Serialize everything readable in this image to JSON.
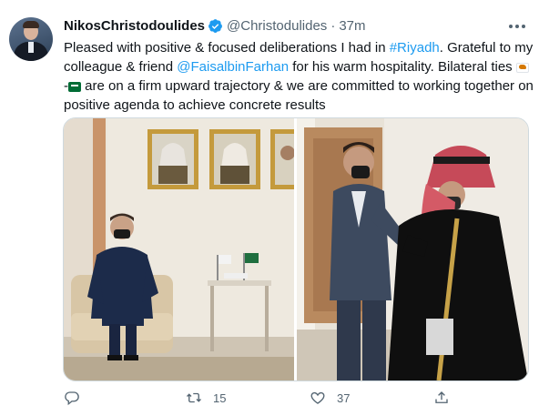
{
  "tweet": {
    "author_name": "NikosChristodoulides",
    "author_handle": "@Christodulides",
    "separator": "·",
    "timestamp": "37m",
    "text": {
      "p1": "Pleased with positive & focused deliberations I had in ",
      "hashtag": "#Riyadh",
      "p2": ". Grateful to my colleague & friend ",
      "mention": "@FaisalbinFarhan",
      "p3": " for his warm hospitality. Bilateral ties ",
      "flag_sep": "-",
      "p4": " are on a firm upward trajectory & we are committed to working together on positive agenda to achieve concrete results"
    },
    "flags": [
      "cyprus-flag",
      "saudi-arabia-flag"
    ],
    "photos": [
      "meeting-room-photo",
      "elbow-bump-photo"
    ],
    "stats": {
      "replies": "",
      "retweets": "15",
      "likes": "37"
    },
    "icons": [
      "verified-badge-icon",
      "more-icon",
      "reply-icon",
      "retweet-icon",
      "like-icon",
      "share-icon"
    ],
    "colors": {
      "link": "#1d9bf0",
      "secondary": "#536471",
      "text": "#0f1419",
      "verified": "#1d9bf0"
    }
  }
}
